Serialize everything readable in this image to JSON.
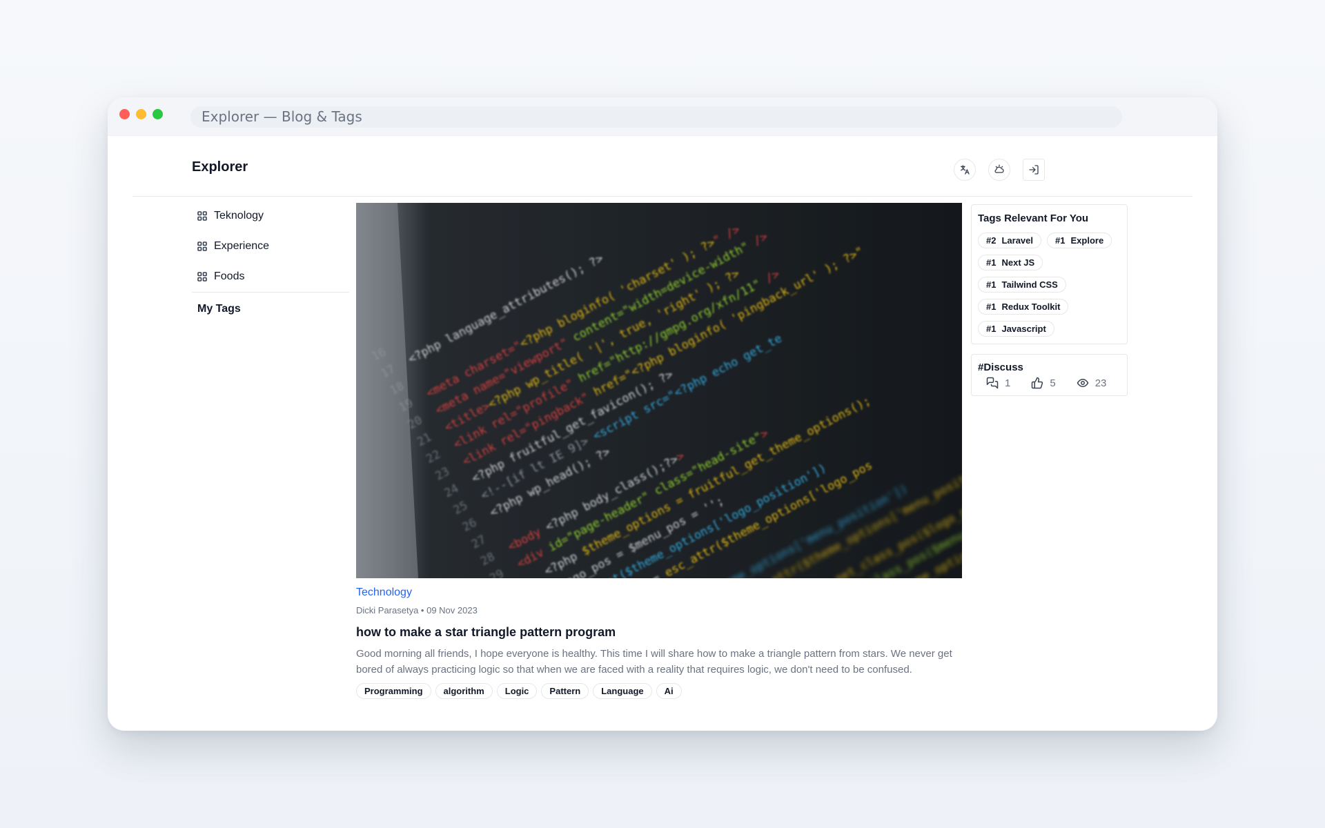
{
  "window": {
    "title": "Explorer — Blog & Tags"
  },
  "header": {
    "logo": "Explorer",
    "icons": [
      "translate-icon",
      "weather-icon",
      "login-icon"
    ]
  },
  "sidebar": {
    "items": [
      {
        "label": "Teknology",
        "icon": "grid-icon"
      },
      {
        "label": "Experience",
        "icon": "grid-icon"
      },
      {
        "label": "Foods",
        "icon": "grid-icon"
      }
    ],
    "my_tags_label": "My Tags"
  },
  "post": {
    "category": "Technology",
    "meta": "Dicki Parasetya • 09 Nov 2023",
    "title": "how to make a star triangle pattern program",
    "excerpt": "Good morning all friends, I hope everyone is healthy. This time I will share how to make a triangle pattern from stars. We never get bored of always practicing logic so that when we are faced with a reality that requires logic, we don't need to be confused.",
    "tags": [
      "Programming",
      "algorithm",
      "Logic",
      "Pattern",
      "Language",
      "Ai"
    ],
    "image": "code-editor-photo"
  },
  "relevant_tags": {
    "title": "Tags Relevant For You",
    "items": [
      {
        "rank": "#2",
        "name": "Laravel"
      },
      {
        "rank": "#1",
        "name": "Explore"
      },
      {
        "rank": "#1",
        "name": "Next JS"
      },
      {
        "rank": "#1",
        "name": "Tailwind CSS"
      },
      {
        "rank": "#1",
        "name": "Redux Toolkit"
      },
      {
        "rank": "#1",
        "name": "Javascript"
      }
    ]
  },
  "discuss": {
    "title": "#Discuss",
    "comments": "1",
    "likes": "5",
    "views": "23"
  },
  "colors": {
    "accent": "#2563eb",
    "traffic_red": "#ff5f57",
    "traffic_yellow": "#febc2e",
    "traffic_green": "#28c840"
  }
}
